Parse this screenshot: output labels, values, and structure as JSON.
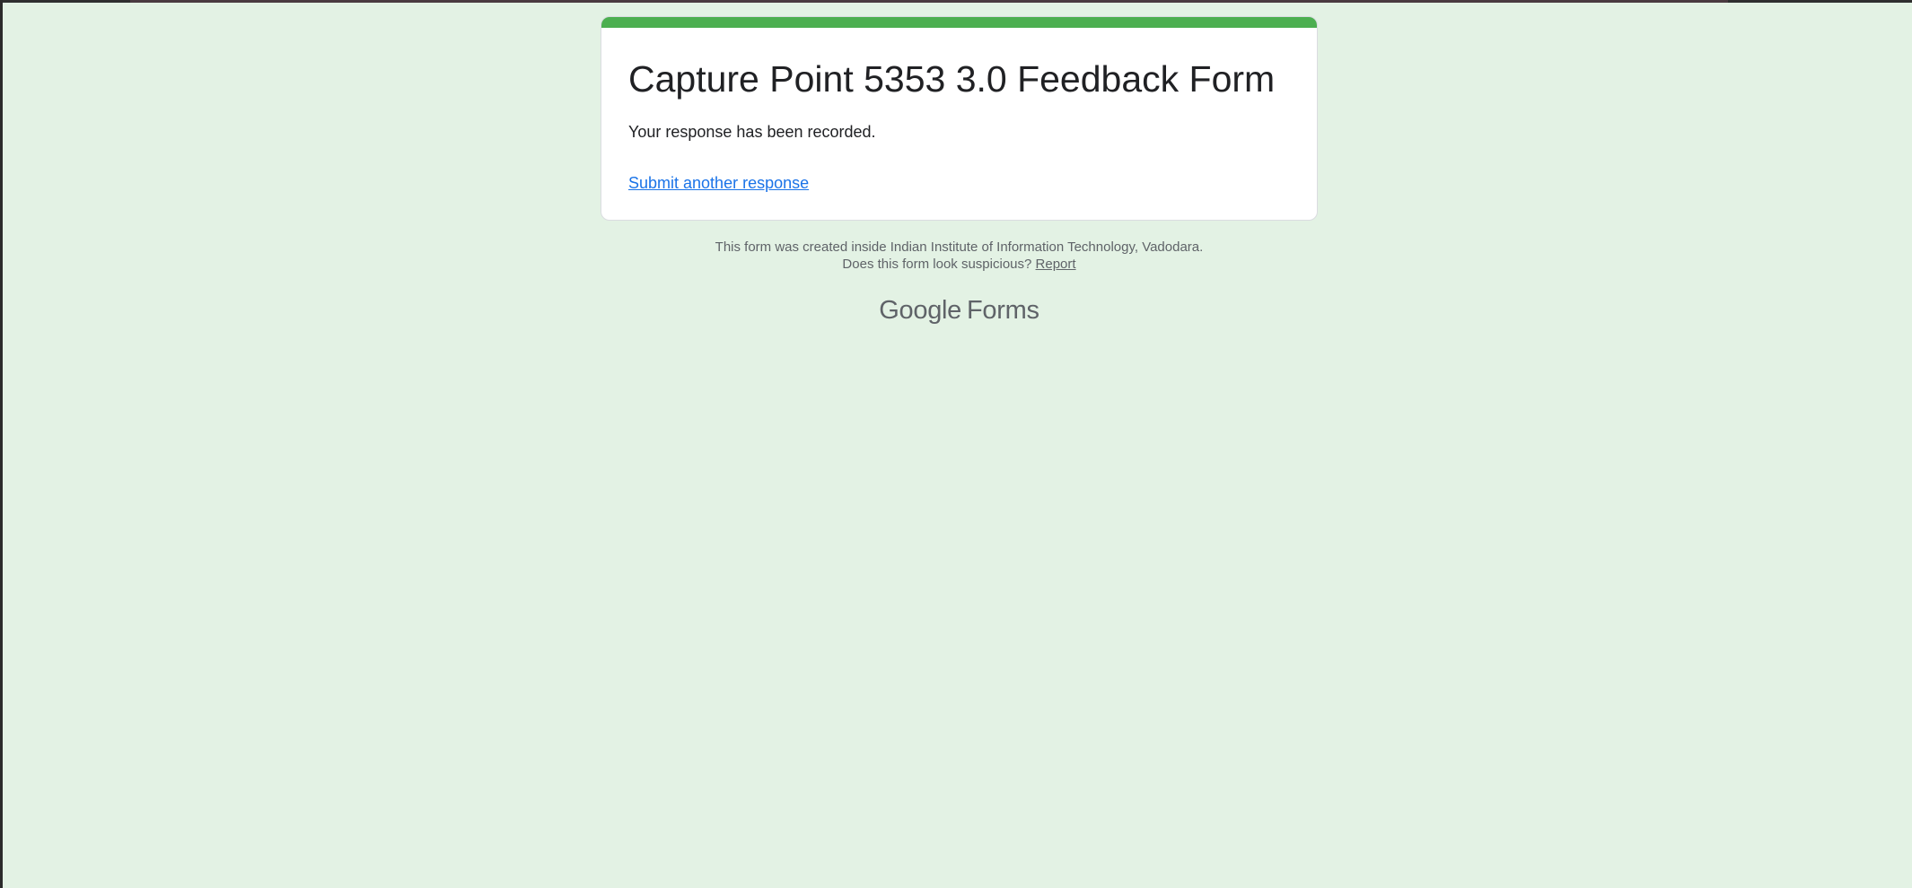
{
  "form": {
    "title": "Capture Point 5353 3.0 Feedback Form",
    "confirmation_message": "Your response has been recorded.",
    "submit_another_label": "Submit another response"
  },
  "footer": {
    "created_inside": "This form was created inside Indian Institute of Information Technology, Vadodara.",
    "suspicious_prompt": "Does this form look suspicious?",
    "report_label": "Report"
  },
  "branding": {
    "google": "Google",
    "forms": "Forms"
  },
  "colors": {
    "background": "#e3f2e4",
    "accent": "#4caf50",
    "link": "#1a73e8",
    "text_primary": "#202124",
    "text_secondary": "#5f6368"
  }
}
